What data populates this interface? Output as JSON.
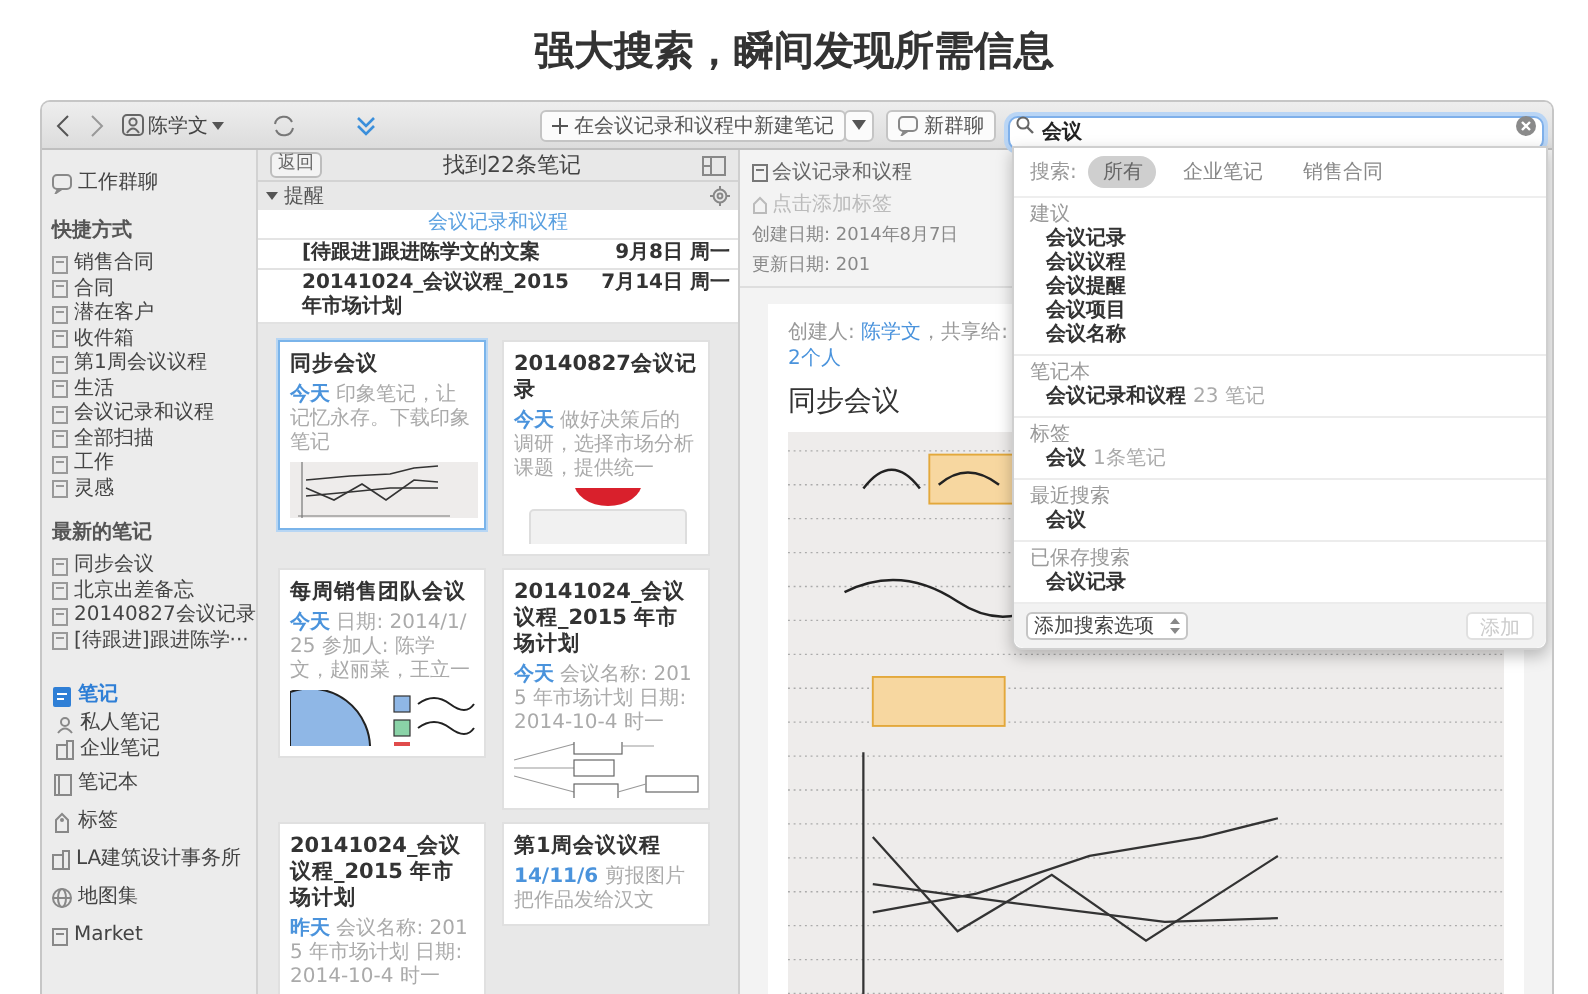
{
  "heading": "强大搜索，瞬间发现所需信息",
  "toolbar": {
    "user": "陈学文",
    "new_note_button": "在会议记录和议程中新建笔记",
    "new_chat_button": "新群聊",
    "search": {
      "value": "会议"
    }
  },
  "sidebar": {
    "work_chat": {
      "label": "工作群聊",
      "selected": false
    },
    "shortcuts": {
      "title": "快捷方式",
      "items": [
        {
          "label": "销售合同",
          "selected": false
        },
        {
          "label": "合同",
          "selected": false
        },
        {
          "label": "潜在客户",
          "selected": false
        },
        {
          "label": "收件箱",
          "selected": false
        },
        {
          "label": "第1周会议议程",
          "selected": false
        },
        {
          "label": "生活",
          "selected": false
        },
        {
          "label": "会议记录和议程",
          "selected": false
        },
        {
          "label": "全部扫描",
          "selected": false
        },
        {
          "label": "工作",
          "selected": false
        },
        {
          "label": "灵感",
          "selected": false
        }
      ]
    },
    "recent": {
      "title": "最新的笔记",
      "items": [
        {
          "label": "同步会议",
          "selected": false
        },
        {
          "label": "北京出差备忘",
          "selected": false
        },
        {
          "label": "20140827会议记录",
          "selected": false
        },
        {
          "label": "[待跟进]跟进陈学···",
          "selected": false
        }
      ]
    },
    "nav": [
      {
        "label": "笔记",
        "selected": true,
        "children": [
          {
            "label": "私人笔记",
            "selected": false
          },
          {
            "label": "企业笔记",
            "selected": false
          }
        ]
      },
      {
        "label": "笔记本",
        "selected": false
      },
      {
        "label": "标签",
        "selected": false
      },
      {
        "label": "LA建筑设计事务所",
        "selected": false
      },
      {
        "label": "地图集",
        "selected": false
      },
      {
        "label": "Market",
        "selected": false
      }
    ]
  },
  "note_list": {
    "back_button": "返回",
    "title": "找到22条笔记",
    "reminders": {
      "title": "提醒",
      "expanded": true,
      "notebook": "会议记录和议程",
      "items": [
        {
          "title": "[待跟进]跟进陈学文的文案",
          "date": "9月8日 周一"
        },
        {
          "title": "20141024_会议议程_2015 年市场计划",
          "date": "7月14日 周一"
        }
      ]
    },
    "cards": [
      {
        "title": "同步会议",
        "date": "今天",
        "snippet": "印象笔记，让记忆永存。下载印象笔记",
        "selected": true,
        "kind": "chart"
      },
      {
        "title": "20140827会议记录",
        "date": "今天",
        "snippet": "做好决策后的调研，选择市场分析课题，提供统一",
        "selected": false,
        "kind": "video"
      },
      {
        "title": "每周销售团队会议",
        "date": "今天",
        "snippet": "日期: 2014/1/25 参加人: 陈学文，赵丽菜，王立一",
        "selected": false,
        "kind": "pie"
      },
      {
        "title": "20141024_会议议程_2015 年市场计划",
        "date": "今天",
        "snippet": "会议名称: 2015 年市场计划 日期: 2014-10-4 时一",
        "selected": false,
        "kind": "diagram"
      },
      {
        "title": "20141024_会议议程_2015 年市场计划",
        "date": "昨天",
        "snippet": "会议名称: 2015 年市场计划 日期: 2014-10-4 时一",
        "selected": false,
        "kind": "none"
      },
      {
        "title": "第1周会议议程",
        "date": "14/11/6",
        "snippet": "剪报图片把作品发给汉文",
        "selected": false,
        "kind": "none"
      }
    ]
  },
  "note": {
    "notebook": "会议记录和议程",
    "tag_hint": "点击添加标签",
    "created": "创建日期: 2014年8月7日",
    "updated": "更新日期: 201",
    "author_label": "创建人: ",
    "author": "陈学文",
    "share_label": "，共享给: ",
    "shared": "2个人",
    "title": "同步会议"
  },
  "search_dropdown": {
    "scope_label": "搜索:",
    "scopes": [
      {
        "label": "所有",
        "selected": true
      },
      {
        "label": "企业笔记",
        "selected": false
      },
      {
        "label": "销售合同",
        "selected": false
      }
    ],
    "sections": [
      {
        "title": "建议",
        "items": [
          {
            "text": "会议记录"
          },
          {
            "text": "会议议程"
          },
          {
            "text": "会议提醒"
          },
          {
            "text": "会议项目"
          },
          {
            "text": "会议名称"
          }
        ]
      },
      {
        "title": "笔记本",
        "items": [
          {
            "text": "会议记录和议程",
            "count": "23 笔记"
          }
        ]
      },
      {
        "title": "标签",
        "items": [
          {
            "text": "会议",
            "count": "1条笔记"
          }
        ]
      },
      {
        "title": "最近搜索",
        "items": [
          {
            "text": "会议"
          }
        ]
      },
      {
        "title": "已保存搜索",
        "items": [
          {
            "text": "会议记录"
          }
        ]
      }
    ],
    "options_select": "添加搜索选项",
    "add_button": {
      "label": "添加",
      "disabled": true
    }
  }
}
